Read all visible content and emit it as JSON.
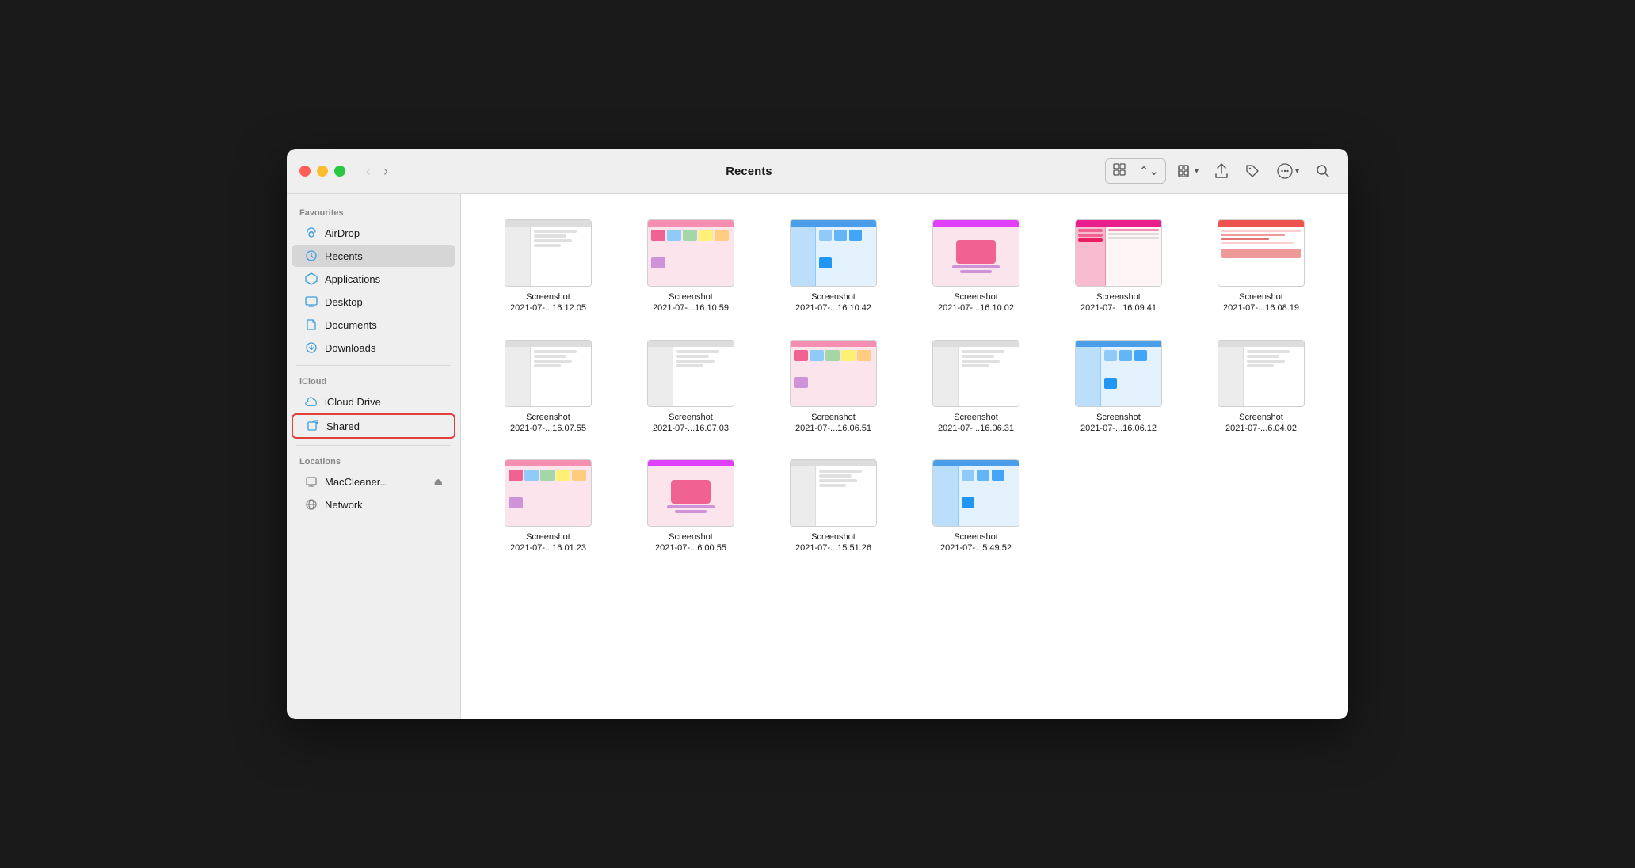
{
  "window": {
    "title": "Recents"
  },
  "controls": {
    "close": "close",
    "minimize": "minimize",
    "maximize": "maximize"
  },
  "nav": {
    "back_label": "‹",
    "forward_label": "›"
  },
  "toolbar": {
    "view_grid_label": "⊞",
    "view_list_label": "≡",
    "share_label": "↑",
    "tag_label": "◇",
    "more_label": "•••",
    "search_label": "⌕"
  },
  "sidebar": {
    "favourites_label": "Favourites",
    "icloud_label": "iCloud",
    "locations_label": "Locations",
    "items": [
      {
        "id": "airdrop",
        "label": "AirDrop",
        "icon": "airdrop"
      },
      {
        "id": "recents",
        "label": "Recents",
        "icon": "recents",
        "active": true
      },
      {
        "id": "applications",
        "label": "Applications",
        "icon": "apps"
      },
      {
        "id": "desktop",
        "label": "Desktop",
        "icon": "desktop"
      },
      {
        "id": "documents",
        "label": "Documents",
        "icon": "docs"
      },
      {
        "id": "downloads",
        "label": "Downloads",
        "icon": "downloads"
      }
    ],
    "icloud_items": [
      {
        "id": "icloud-drive",
        "label": "iCloud Drive",
        "icon": "icloud"
      },
      {
        "id": "shared",
        "label": "Shared",
        "icon": "shared",
        "selected": true
      }
    ],
    "location_items": [
      {
        "id": "maccleaner",
        "label": "MacCleaner...",
        "icon": "mac",
        "eject": true
      },
      {
        "id": "network",
        "label": "Network",
        "icon": "network"
      }
    ]
  },
  "files": [
    {
      "name": "Screenshot",
      "date": "2021-07-...16.12.05",
      "thumb": "1"
    },
    {
      "name": "Screenshot",
      "date": "2021-07-...16.10.59",
      "thumb": "2"
    },
    {
      "name": "Screenshot",
      "date": "2021-07-...16.10.42",
      "thumb": "3"
    },
    {
      "name": "Screenshot",
      "date": "2021-07-...16.10.02",
      "thumb": "4"
    },
    {
      "name": "Screenshot",
      "date": "2021-07-...16.09.41",
      "thumb": "5"
    },
    {
      "name": "Screenshot",
      "date": "2021-07-...16.08.19",
      "thumb": "6"
    },
    {
      "name": "Screenshot",
      "date": "2021-07-...16.07.55",
      "thumb": "1"
    },
    {
      "name": "Screenshot",
      "date": "2021-07-...16.07.03",
      "thumb": "1"
    },
    {
      "name": "Screenshot",
      "date": "2021-07-...16.06.51",
      "thumb": "2"
    },
    {
      "name": "Screenshot",
      "date": "2021-07-...16.06.31",
      "thumb": "1"
    },
    {
      "name": "Screenshot",
      "date": "2021-07-...16.06.12",
      "thumb": "3"
    },
    {
      "name": "Screenshot",
      "date": "2021-07-...6.04.02",
      "thumb": "1"
    },
    {
      "name": "Screenshot",
      "date": "2021-07-...16.01.23",
      "thumb": "2"
    },
    {
      "name": "Screenshot",
      "date": "2021-07-...6.00.55",
      "thumb": "4"
    },
    {
      "name": "Screenshot",
      "date": "2021-07-...15.51.26",
      "thumb": "1"
    },
    {
      "name": "Screenshot",
      "date": "2021-07-...5.49.52",
      "thumb": "3"
    }
  ]
}
